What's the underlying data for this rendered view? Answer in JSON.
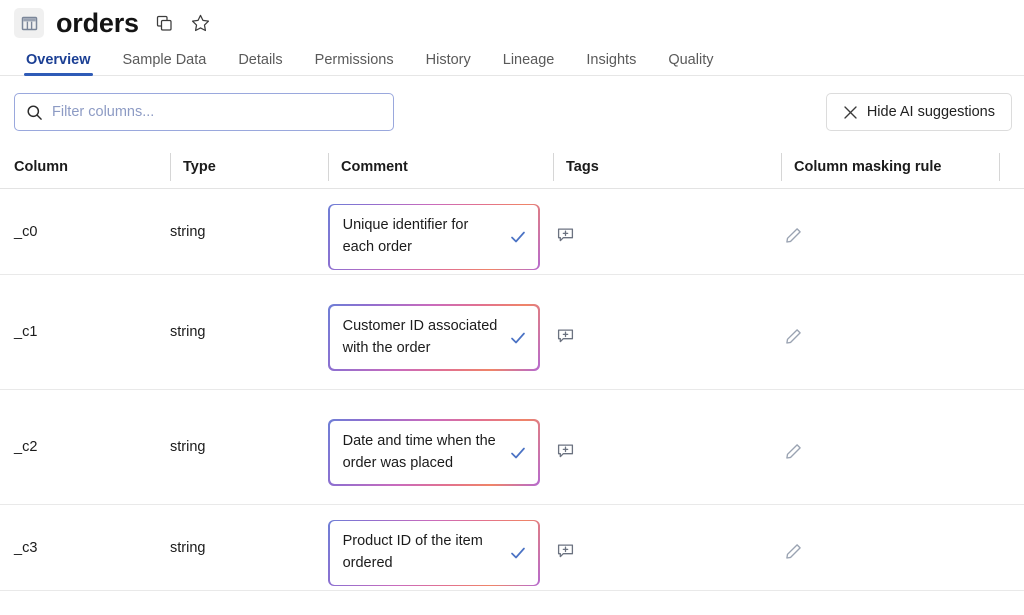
{
  "header": {
    "title": "orders",
    "table_icon": "table-icon",
    "copy_icon": "copy-icon",
    "favorite_icon": "star-icon"
  },
  "tabs": [
    {
      "label": "Overview",
      "active": true
    },
    {
      "label": "Sample Data",
      "active": false
    },
    {
      "label": "Details",
      "active": false
    },
    {
      "label": "Permissions",
      "active": false
    },
    {
      "label": "History",
      "active": false
    },
    {
      "label": "Lineage",
      "active": false
    },
    {
      "label": "Insights",
      "active": false
    },
    {
      "label": "Quality",
      "active": false
    }
  ],
  "toolbar": {
    "filter": {
      "placeholder": "Filter columns...",
      "value": "",
      "icon": "search-icon"
    },
    "hide_ai_button": {
      "label": "Hide AI suggestions",
      "icon": "close-icon"
    }
  },
  "table": {
    "headers": {
      "column": "Column",
      "type": "Type",
      "comment": "Comment",
      "tags": "Tags",
      "masking_rule": "Column masking rule"
    },
    "rows": [
      {
        "column": "_c0",
        "type": "string",
        "comment": "Unique identifier for each order",
        "tags_icon": "add-comment-icon",
        "mask_icon": "pencil-icon",
        "accept_icon": "check-icon"
      },
      {
        "column": "_c1",
        "type": "string",
        "comment": "Customer ID associated with the order",
        "tags_icon": "add-comment-icon",
        "mask_icon": "pencil-icon",
        "accept_icon": "check-icon"
      },
      {
        "column": "_c2",
        "type": "string",
        "comment": "Date and time when the order was placed",
        "tags_icon": "add-comment-icon",
        "mask_icon": "pencil-icon",
        "accept_icon": "check-icon"
      },
      {
        "column": "_c3",
        "type": "string",
        "comment": "Product ID of the item ordered",
        "tags_icon": "add-comment-icon",
        "mask_icon": "pencil-icon",
        "accept_icon": "check-icon"
      }
    ]
  },
  "colors": {
    "accent_blue": "#2f5bb7",
    "active_tab_text": "#1b3f94",
    "filter_border": "#9aa8dd",
    "check_blue": "#4a72c4",
    "gradient_start": "#6e7fd6",
    "gradient_mid": "#c96bbd",
    "gradient_end": "#ef8468"
  }
}
